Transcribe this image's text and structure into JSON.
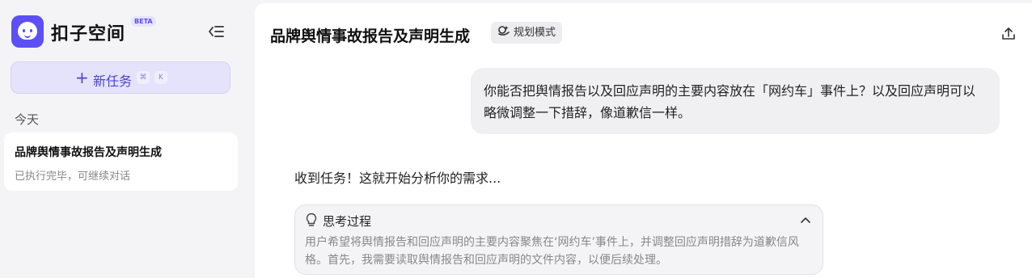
{
  "sidebar": {
    "brand": "扣子空间",
    "beta_label": "BETA",
    "new_task_label": "新任务",
    "shortcut_keys": [
      "⌘",
      "K"
    ],
    "section_today": "今天",
    "tasks": [
      {
        "title": "品牌舆情事故报告及声明生成",
        "status": "已执行完毕，可继续对话"
      }
    ]
  },
  "main": {
    "title": "品牌舆情事故报告及声明生成",
    "mode_label": "规划模式",
    "user_message": "你能否把舆情报告以及回应声明的主要内容放在「网约车」事件上？以及回应声明可以略微调整一下措辞，像道歉信一样。",
    "assistant_reply": "收到任务！这就开始分析你的需求...",
    "thinking": {
      "header": "思考过程",
      "body": "用户希望将舆情报告和回应声明的主要内容聚焦在‘网约车’事件上，并调整回应声明措辞为道歉信风格。首先，我需要读取舆情报告和回应声明的文件内容，以便后续处理。"
    }
  },
  "colors": {
    "accent": "#5b4ff5",
    "sidebar_bg": "#f4f4f6",
    "new_task_bg": "#e5e3fb"
  }
}
